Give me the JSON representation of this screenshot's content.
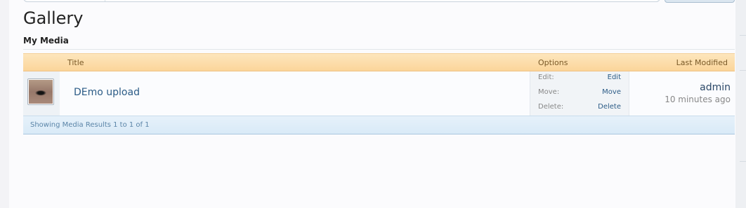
{
  "page": {
    "title": "Gallery",
    "section_title": "My Media"
  },
  "table": {
    "columns": {
      "title": "Title",
      "options": "Options",
      "last_modified": "Last Modified"
    },
    "rows": [
      {
        "title": "DEmo upload",
        "thumbnail": "eye-photo-thumbnail",
        "options": [
          {
            "label": "Edit:",
            "action": "Edit"
          },
          {
            "label": "Move:",
            "action": "Move"
          },
          {
            "label": "Delete:",
            "action": "Delete"
          }
        ],
        "modified_by": "admin",
        "modified_ago": "10 minutes ago"
      }
    ],
    "footer": "Showing Media Results 1 to 1 of 1"
  },
  "colors": {
    "header_bg": "#fbd59a",
    "footer_bg": "#d9eaf7",
    "link": "#2b5b86"
  }
}
